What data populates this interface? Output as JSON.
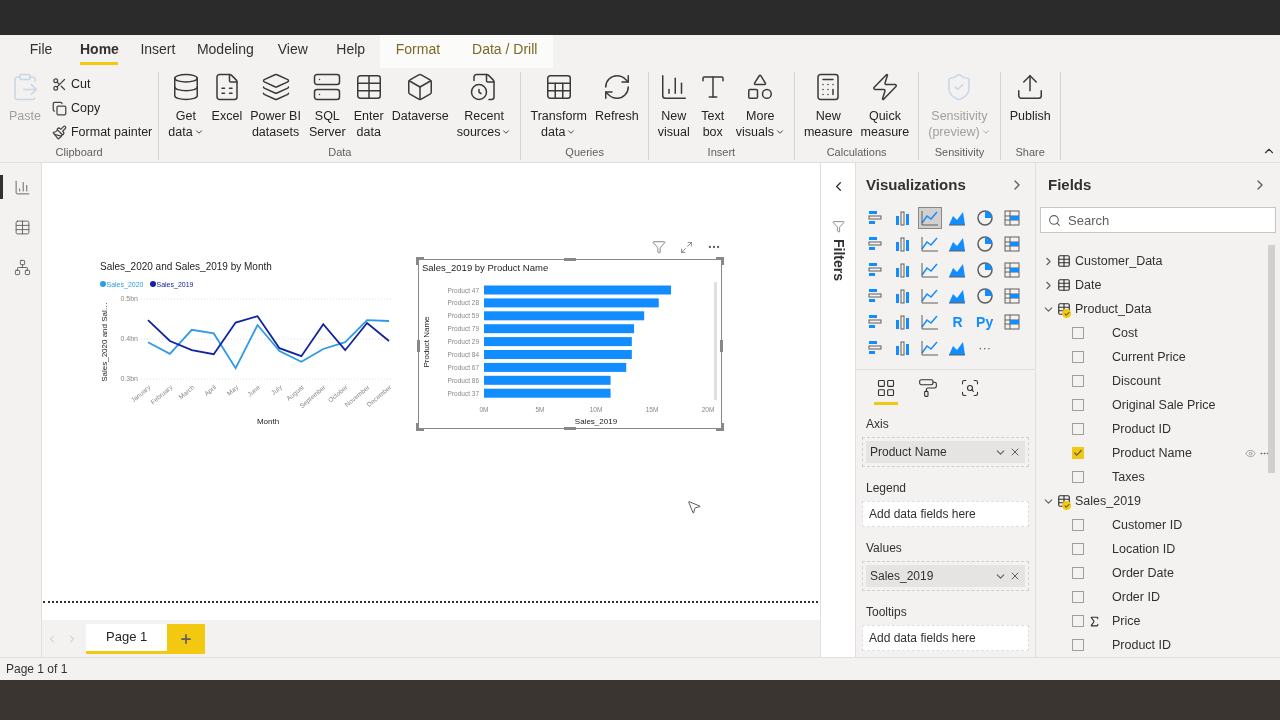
{
  "menu_tabs": [
    {
      "label": "File",
      "selected": false,
      "kind": "standard"
    },
    {
      "label": "Home",
      "selected": true,
      "kind": "standard"
    },
    {
      "label": "Insert",
      "selected": false,
      "kind": "standard"
    },
    {
      "label": "Modeling",
      "selected": false,
      "kind": "standard"
    },
    {
      "label": "View",
      "selected": false,
      "kind": "standard"
    },
    {
      "label": "Help",
      "selected": false,
      "kind": "standard"
    },
    {
      "label": "Format",
      "selected": false,
      "kind": "contextual"
    },
    {
      "label": "Data / Drill",
      "selected": false,
      "kind": "contextual"
    }
  ],
  "ribbon": {
    "groups": [
      {
        "label": "Clipboard",
        "buttons": [
          {
            "kind": "large",
            "lines": [
              "Paste"
            ],
            "dropdown": false,
            "disabled": true
          },
          {
            "kind": "small",
            "lines": [
              "Cut"
            ],
            "disabled": false
          },
          {
            "kind": "small",
            "lines": [
              "Copy"
            ],
            "disabled": false
          },
          {
            "kind": "small",
            "lines": [
              "Format painter"
            ],
            "disabled": false
          }
        ]
      },
      {
        "label": "Data",
        "buttons": [
          {
            "kind": "large",
            "lines": [
              "Get",
              "data"
            ],
            "dropdown": true,
            "disabled": false
          },
          {
            "kind": "large",
            "lines": [
              "Excel"
            ],
            "dropdown": false,
            "disabled": false
          },
          {
            "kind": "large",
            "lines": [
              "Power BI",
              "datasets"
            ],
            "dropdown": false,
            "disabled": false
          },
          {
            "kind": "large",
            "lines": [
              "SQL",
              "Server"
            ],
            "dropdown": false,
            "disabled": false
          },
          {
            "kind": "large",
            "lines": [
              "Enter",
              "data"
            ],
            "dropdown": false,
            "disabled": false
          },
          {
            "kind": "large",
            "lines": [
              "Dataverse"
            ],
            "dropdown": false,
            "disabled": false
          },
          {
            "kind": "large",
            "lines": [
              "Recent",
              "sources"
            ],
            "dropdown": true,
            "disabled": false
          }
        ]
      },
      {
        "label": "Queries",
        "buttons": [
          {
            "kind": "large",
            "lines": [
              "Transform",
              "data"
            ],
            "dropdown": true,
            "disabled": false
          },
          {
            "kind": "large",
            "lines": [
              "Refresh"
            ],
            "dropdown": false,
            "disabled": false
          }
        ]
      },
      {
        "label": "Insert",
        "buttons": [
          {
            "kind": "large",
            "lines": [
              "New",
              "visual"
            ],
            "dropdown": false,
            "disabled": false
          },
          {
            "kind": "large",
            "lines": [
              "Text",
              "box"
            ],
            "dropdown": false,
            "disabled": false
          },
          {
            "kind": "large",
            "lines": [
              "More",
              "visuals"
            ],
            "dropdown": true,
            "disabled": false
          }
        ]
      },
      {
        "label": "Calculations",
        "buttons": [
          {
            "kind": "large",
            "lines": [
              "New",
              "measure"
            ],
            "dropdown": false,
            "disabled": false
          },
          {
            "kind": "large",
            "lines": [
              "Quick",
              "measure"
            ],
            "dropdown": false,
            "disabled": false
          }
        ]
      },
      {
        "label": "Sensitivity",
        "buttons": [
          {
            "kind": "large",
            "lines": [
              "Sensitivity",
              "(preview)"
            ],
            "dropdown": true,
            "disabled": true
          }
        ]
      },
      {
        "label": "Share",
        "buttons": [
          {
            "kind": "large",
            "lines": [
              "Publish"
            ],
            "dropdown": false,
            "disabled": false
          }
        ]
      }
    ]
  },
  "view_switcher": [
    {
      "selected": true
    },
    {
      "selected": false
    },
    {
      "selected": false
    }
  ],
  "visuals": [
    {
      "selected": false,
      "chart_data": {
        "type": "line",
        "title": "Sales_2020 and Sales_2019 by Month",
        "xlabel": "Month",
        "ylabel": "Sales_2020 and Sal…",
        "categories": [
          "January",
          "February",
          "March",
          "April",
          "May",
          "June",
          "July",
          "August",
          "September",
          "October",
          "November",
          "December"
        ],
        "series": [
          {
            "name": "Sales_2020",
            "color": "#2f9be3",
            "values": [
              0.392,
              0.363,
              0.423,
              0.414,
              0.327,
              0.435,
              0.37,
              0.343,
              0.375,
              0.392,
              0.447,
              0.445
            ]
          },
          {
            "name": "Sales_2019",
            "color": "#12239e",
            "values": [
              0.447,
              0.395,
              0.372,
              0.362,
              0.441,
              0.457,
              0.377,
              0.357,
              0.437,
              0.372,
              0.44,
              0.395
            ]
          }
        ],
        "legend": true,
        "ylim": [
          0.3,
          0.5
        ],
        "yticks": [
          {
            "value": 0.3,
            "label": "0.3bn"
          },
          {
            "value": 0.4,
            "label": "0.4bn"
          },
          {
            "value": 0.5,
            "label": "0.5bn"
          }
        ]
      }
    },
    {
      "selected": true,
      "chart_data": {
        "type": "bar",
        "orientation": "horizontal",
        "title": "Sales_2019 by Product Name",
        "xlabel": "Sales_2019",
        "ylabel": "Product Name",
        "categories": [
          "Product 47",
          "Product 28",
          "Product 59",
          "Product 79",
          "Product 29",
          "Product 84",
          "Product 67",
          "Product 86",
          "Product 37"
        ],
        "series": [
          {
            "color": "#118dff",
            "values": [
              16.7,
              15.6,
              14.3,
              13.4,
              13.2,
              13.2,
              12.7,
              11.3,
              11.3
            ]
          }
        ],
        "xlim": [
          0,
          20
        ],
        "xticks": [
          {
            "value": 0,
            "label": "0M"
          },
          {
            "value": 5,
            "label": "5M"
          },
          {
            "value": 10,
            "label": "10M"
          },
          {
            "value": 15,
            "label": "15M"
          },
          {
            "value": 20,
            "label": "20M"
          }
        ]
      }
    }
  ],
  "page_tabs": [
    {
      "label": "Page 1",
      "selected": true
    }
  ],
  "status_bar": {
    "text": "Page 1 of 1"
  },
  "filters_pane": {
    "label": "Filters"
  },
  "visualizations": {
    "title": "Visualizations",
    "types": [
      {
        "kind": "chart",
        "selected": false
      },
      {
        "kind": "chart",
        "selected": false
      },
      {
        "kind": "chart",
        "selected": true
      },
      {
        "kind": "chart",
        "selected": false
      },
      {
        "kind": "chart",
        "selected": false
      },
      {
        "kind": "chart",
        "selected": false
      },
      {
        "kind": "chart",
        "selected": false
      },
      {
        "kind": "chart",
        "selected": false
      },
      {
        "kind": "chart",
        "selected": false
      },
      {
        "kind": "chart",
        "selected": false
      },
      {
        "kind": "chart",
        "selected": false
      },
      {
        "kind": "chart",
        "selected": false
      },
      {
        "kind": "chart",
        "selected": false
      },
      {
        "kind": "chart",
        "selected": false
      },
      {
        "kind": "chart",
        "selected": false
      },
      {
        "kind": "chart",
        "selected": false
      },
      {
        "kind": "chart",
        "selected": false
      },
      {
        "kind": "chart",
        "selected": false
      },
      {
        "kind": "chart",
        "selected": false
      },
      {
        "kind": "chart",
        "selected": false
      },
      {
        "kind": "chart",
        "selected": false
      },
      {
        "kind": "chart",
        "selected": false
      },
      {
        "kind": "chart",
        "selected": false
      },
      {
        "kind": "chart",
        "selected": false
      },
      {
        "kind": "chart",
        "selected": false
      },
      {
        "kind": "chart",
        "selected": false
      },
      {
        "kind": "chart",
        "selected": false
      },
      {
        "kind": "text",
        "label": "R",
        "selected": false
      },
      {
        "kind": "text",
        "label": "Py",
        "selected": false
      },
      {
        "kind": "chart",
        "selected": false
      },
      {
        "kind": "chart",
        "selected": false
      },
      {
        "kind": "chart",
        "selected": false
      },
      {
        "kind": "chart",
        "selected": false
      },
      {
        "kind": "chart",
        "selected": false
      },
      {
        "kind": "more",
        "label": "···",
        "selected": false
      }
    ],
    "pane_tabs": [
      {
        "selected": true
      },
      {
        "selected": false
      },
      {
        "selected": false
      }
    ],
    "wells": [
      {
        "label": "Axis",
        "field": "Product Name"
      },
      {
        "label": "Legend",
        "placeholder": "Add data fields here"
      },
      {
        "label": "Values",
        "field": "Sales_2019"
      },
      {
        "label": "Tooltips",
        "placeholder": "Add data fields here"
      }
    ]
  },
  "fields": {
    "title": "Fields",
    "search_placeholder": "Search",
    "tables": [
      {
        "name": "Customer_Data",
        "expanded": false,
        "in_use": false
      },
      {
        "name": "Date",
        "expanded": false,
        "in_use": false
      },
      {
        "name": "Product_Data",
        "expanded": true,
        "in_use": true,
        "children": [
          {
            "name": "Cost",
            "checked": false,
            "kind": "field",
            "hovered": false
          },
          {
            "name": "Current Price",
            "checked": false,
            "kind": "field",
            "hovered": false
          },
          {
            "name": "Discount",
            "checked": false,
            "kind": "field",
            "hovered": false
          },
          {
            "name": "Original Sale Price",
            "checked": false,
            "kind": "field",
            "hovered": false
          },
          {
            "name": "Product ID",
            "checked": false,
            "kind": "field",
            "hovered": false
          },
          {
            "name": "Product Name",
            "checked": true,
            "kind": "field",
            "hovered": true
          },
          {
            "name": "Taxes",
            "checked": false,
            "kind": "field",
            "hovered": false
          }
        ]
      },
      {
        "name": "Sales_2019",
        "expanded": true,
        "in_use": true,
        "children": [
          {
            "name": "Customer ID",
            "checked": false,
            "kind": "field",
            "hovered": false
          },
          {
            "name": "Location ID",
            "checked": false,
            "kind": "field",
            "hovered": false
          },
          {
            "name": "Order Date",
            "checked": false,
            "kind": "field",
            "hovered": false
          },
          {
            "name": "Order ID",
            "checked": false,
            "kind": "field",
            "hovered": false
          },
          {
            "name": "Price",
            "checked": false,
            "kind": "sum",
            "hovered": false
          },
          {
            "name": "Product ID",
            "checked": false,
            "kind": "field",
            "hovered": false
          }
        ]
      }
    ]
  }
}
